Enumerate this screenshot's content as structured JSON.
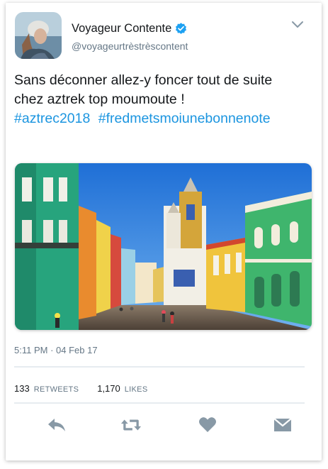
{
  "user": {
    "display_name": "Voyageur Contente",
    "handle": "@voyageurtrèstrèscontent"
  },
  "tweet": {
    "text_line1": "Sans déconner allez-y foncer tout de suite",
    "text_line2": "chez aztrek top moumoute !",
    "hashtags": [
      "#aztrec2018",
      "#fredmetsmoiunebonnenote"
    ]
  },
  "meta": {
    "time": "5:11 PM",
    "separator": "·",
    "date": "04 Feb 17"
  },
  "stats": {
    "retweets_count": "133",
    "retweets_label": "RETWEETS",
    "likes_count": "1,170",
    "likes_label": "LIKES"
  },
  "icons": {
    "verified": "verified-badge-icon",
    "caret": "chevron-down-icon",
    "reply": "reply-icon",
    "retweet": "retweet-icon",
    "like": "heart-icon",
    "message": "envelope-icon"
  },
  "colors": {
    "link": "#1b95e0",
    "verified": "#1da1f2",
    "icon": "#8899a6",
    "text": "#14171a",
    "muted": "#657786"
  }
}
